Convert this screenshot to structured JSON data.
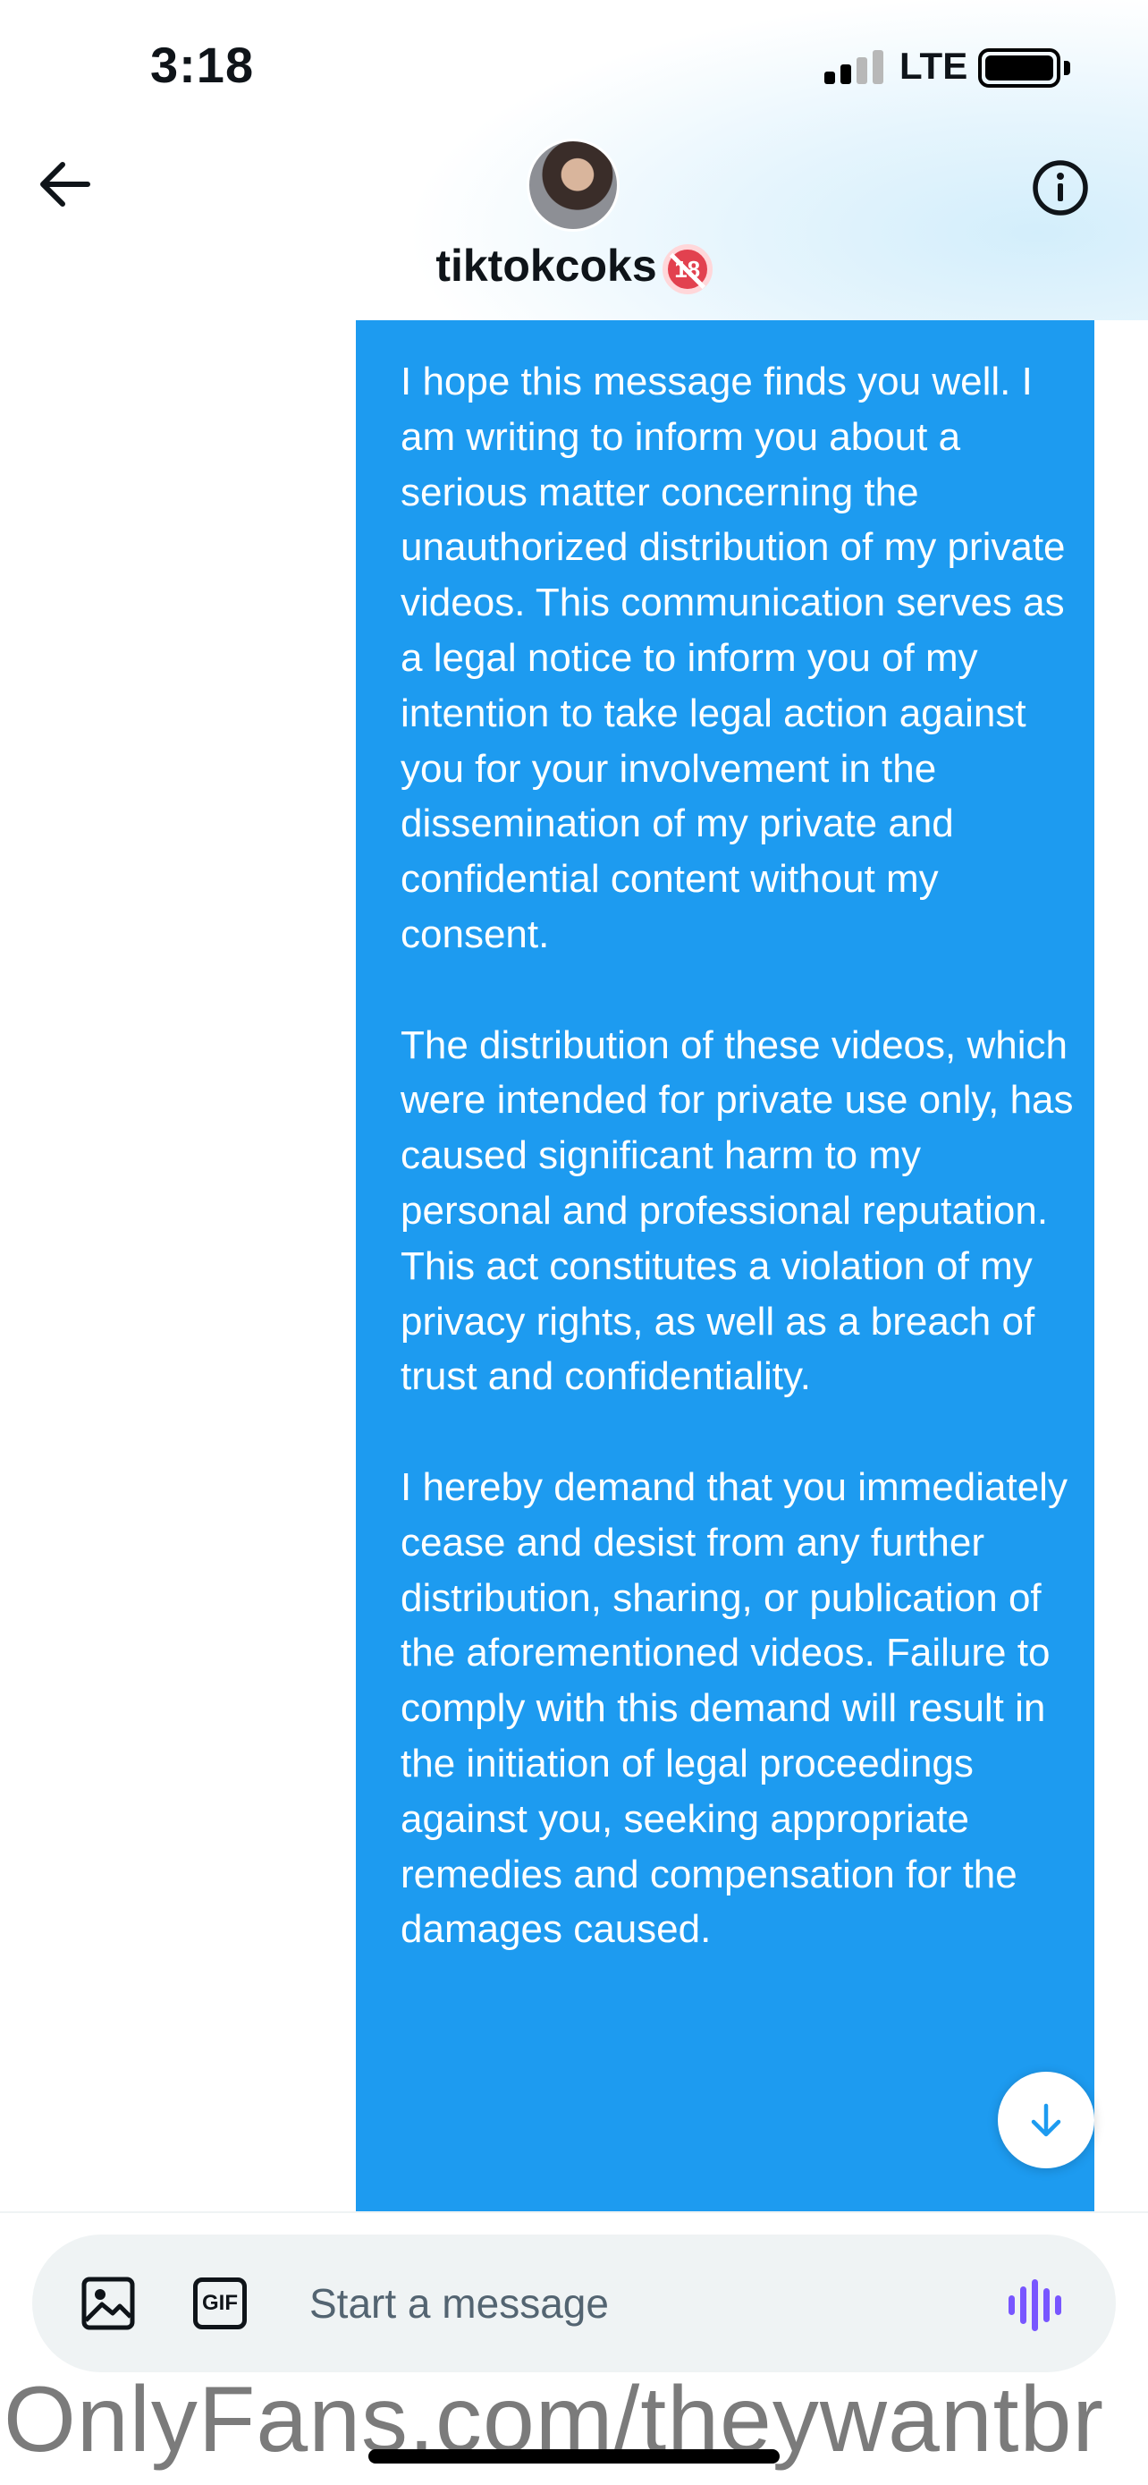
{
  "status_bar": {
    "time": "3:18",
    "network": "LTE"
  },
  "header": {
    "contact_name": "tiktokcoks",
    "age_badge": "18",
    "back_icon": "arrow-left-icon",
    "info_icon": "info-circle-icon"
  },
  "message": {
    "paragraphs": [
      "I hope this message finds you well. I am writing to inform you about a serious matter concerning the unauthorized distribution of my private videos. This communication serves as a legal notice to inform you of my intention to take legal action against you for your involvement in the dissemination of my private and confidential content without my consent.",
      "The distribution of these videos, which were intended for private use only, has caused significant harm to my personal and professional reputation. This act constitutes a violation of my privacy rights, as well as a breach of trust and confidentiality.",
      "I hereby demand that you immediately cease and desist from any further distribution, sharing, or publication of the aforementioned videos. Failure to comply with this demand will result in the initiation of legal proceedings against you, seeking appropriate remedies and compensation for the damages caused."
    ],
    "bubble_color": "#1d9bf0"
  },
  "composer": {
    "placeholder": "Start a message",
    "gif_label": "GIF",
    "image_icon": "image-icon",
    "voice_icon": "voice-waveform-icon",
    "accent_color": "#7856ff"
  },
  "scroll_icon": "arrow-down-icon",
  "watermark": "OnlyFans.com/theywantbr"
}
